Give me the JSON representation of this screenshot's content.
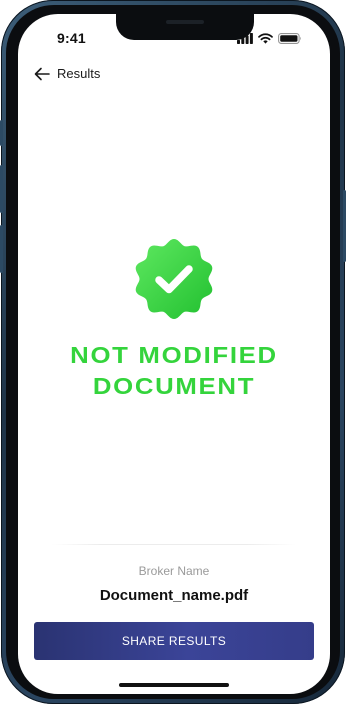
{
  "status_bar": {
    "time": "9:41",
    "icons": [
      "signal-icon",
      "wifi-icon",
      "battery-icon"
    ]
  },
  "nav": {
    "back_icon": "arrow-left-icon",
    "back_label": "Results"
  },
  "result": {
    "badge_icon": "verified-badge-icon",
    "title_line1": "NOT MODIFIED",
    "title_line2": "DOCUMENT",
    "accent_color": "#34d43c"
  },
  "document": {
    "broker_name": "Broker Name",
    "file_name": "Document_name.pdf"
  },
  "actions": {
    "share_label": "SHARE RESULTS",
    "button_color": "#343d8c"
  }
}
